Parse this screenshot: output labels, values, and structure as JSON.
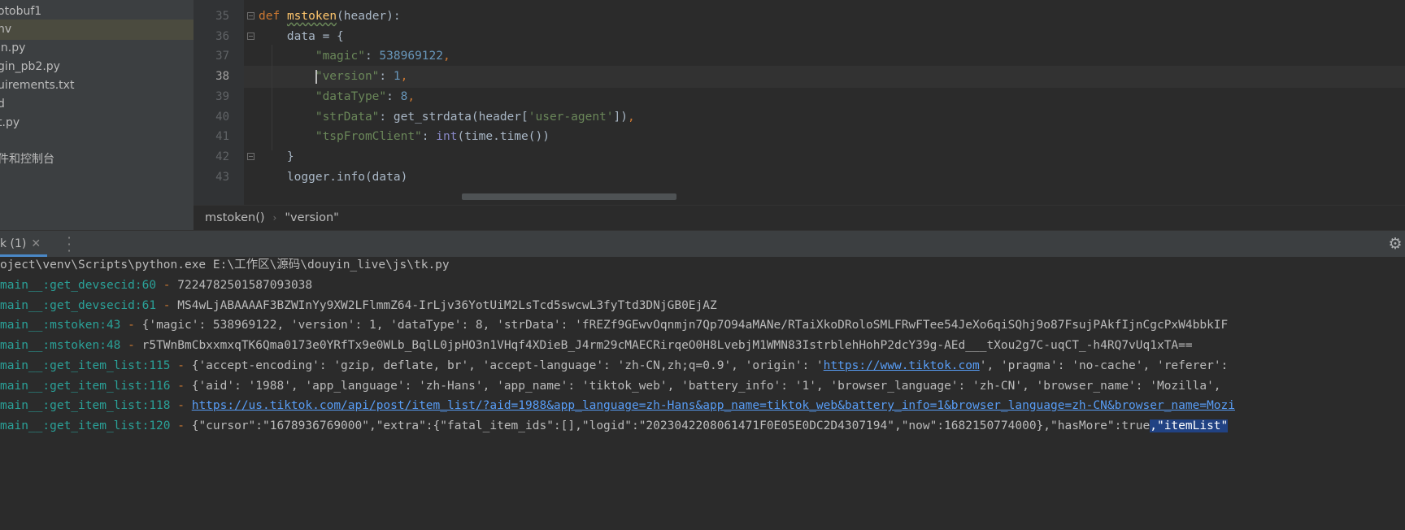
{
  "project_tree": {
    "items": [
      {
        "label": "otobuf1",
        "selected": false
      },
      {
        "label": "nv",
        "selected": true
      },
      {
        "label": "in.py",
        "selected": false
      },
      {
        "label": "gin_pb2.py",
        "selected": false
      },
      {
        "label": "uirements.txt",
        "selected": false
      },
      {
        "label": "d",
        "selected": false
      },
      {
        "label": "t.py",
        "selected": false
      },
      {
        "label": "",
        "selected": false
      },
      {
        "label": "件和控制台",
        "selected": false
      }
    ]
  },
  "editor": {
    "line_numbers": [
      "35",
      "36",
      "37",
      "38",
      "39",
      "40",
      "41",
      "42",
      "43"
    ],
    "current_line": "38",
    "code": {
      "l35_kw": "def",
      "l35_fn": "mstoken",
      "l35_rest": "(header):",
      "l36_text": "    data = {",
      "l37_key": "\"magic\"",
      "l37_colon": ": ",
      "l37_val": "538969122",
      "l37_comma": ",",
      "l38_key": "\"version\"",
      "l38_colon": ": ",
      "l38_val": "1",
      "l38_comma": ",",
      "l39_key": "\"dataType\"",
      "l39_colon": ": ",
      "l39_val": "8",
      "l39_comma": ",",
      "l40_key": "\"strData\"",
      "l40_mid": ": get_strdata(header[",
      "l40_arg": "'user-agent'",
      "l40_end": "])",
      "l40_comma": ",",
      "l41_key": "\"tspFromClient\"",
      "l41_colon": ": ",
      "l41_builtin": "int",
      "l41_end": "(time.time())",
      "l42_text": "    }",
      "l43_text": "    logger.info(data)"
    }
  },
  "breadcrumb": {
    "function": "mstoken()",
    "key": "\"version\""
  },
  "run_window": {
    "tab_label": "k (1)",
    "close_glyph": "✕",
    "gear_glyph": "⚙"
  },
  "console": {
    "lines": [
      {
        "plain": "oject\\venv\\Scripts\\python.exe E:\\工作区\\源码\\douyin_live\\js\\tk.py"
      },
      {
        "module": "main__:get_devsecid:60",
        "dash": " - ",
        "msg": "7224782501587093038"
      },
      {
        "module": "main__:get_devsecid:61",
        "dash": " - ",
        "msg": "MS4wLjABAAAAF3BZWInYy9XW2LFlmmZ64-IrLjv36YotUiM2LsTcd5swcwL3fyTtd3DNjGB0EjAZ"
      },
      {
        "module": "main__:mstoken:43",
        "dash": " - ",
        "msg": "{'magic': 538969122, 'version': 1, 'dataType': 8, 'strData': 'fREZf9GEwvOqnmjn7Qp7O94aMANe/RTaiXkoDRoloSMLFRwFTee54JeXo6qiSQhj9o87FsujPAkfIjnCgcPxW4bbkIF"
      },
      {
        "module": "main__:mstoken:48",
        "dash": " - ",
        "msg": "r5TWnBmCbxxmxqTK6Qma0173e0YRfTx9e0WLb_BqlL0jpHO3n1VHqf4XDieB_J4rm29cMAECRirqeO0H8LvebjM1WMN83IstrblehHohP2dcY39g-AEd___tXou2g7C-uqCT_-h4RQ7vUq1xTA=="
      },
      {
        "module": "main__:get_item_list:115",
        "dash": " - ",
        "msg_a": "{'accept-encoding': 'gzip, deflate, br', 'accept-language': 'zh-CN,zh;q=0.9', 'origin': '",
        "link": "https://www.tiktok.com",
        "msg_b": "', 'pragma': 'no-cache', 'referer': "
      },
      {
        "module": "main__:get_item_list:116",
        "dash": " - ",
        "msg": "{'aid': '1988', 'app_language': 'zh-Hans', 'app_name': 'tiktok_web', 'battery_info': '1', 'browser_language': 'zh-CN', 'browser_name': 'Mozilla', "
      },
      {
        "module": "main__:get_item_list:118",
        "dash": " - ",
        "link": "https://us.tiktok.com/api/post/item_list/?aid=1988&app_language=zh-Hans&app_name=tiktok_web&battery_info=1&browser_language=zh-CN&browser_name=Mozi"
      },
      {
        "module": "main__:get_item_list:120",
        "dash": " - ",
        "msg": "{\"cursor\":\"1678936769000\",\"extra\":{\"fatal_item_ids\":[],\"logid\":\"2023042208061471F0E05E0DC2D4307194\",\"now\":1682150774000},\"hasMore\":true",
        "selected": ",\"itemList\""
      }
    ]
  }
}
